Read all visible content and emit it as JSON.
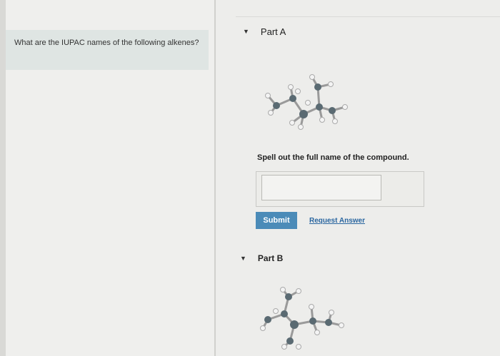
{
  "question": {
    "text": "What are the IUPAC names of the following alkenes?"
  },
  "part_a": {
    "label": "Part A",
    "prompt": "Spell out the full name of the compound.",
    "answer_value": "",
    "submit_label": "Submit",
    "request_answer_label": "Request Answer"
  },
  "part_b": {
    "label": "Part B"
  },
  "icons": {
    "expand": "chevron-down-icon",
    "molecule": "ball-and-stick-molecule"
  }
}
